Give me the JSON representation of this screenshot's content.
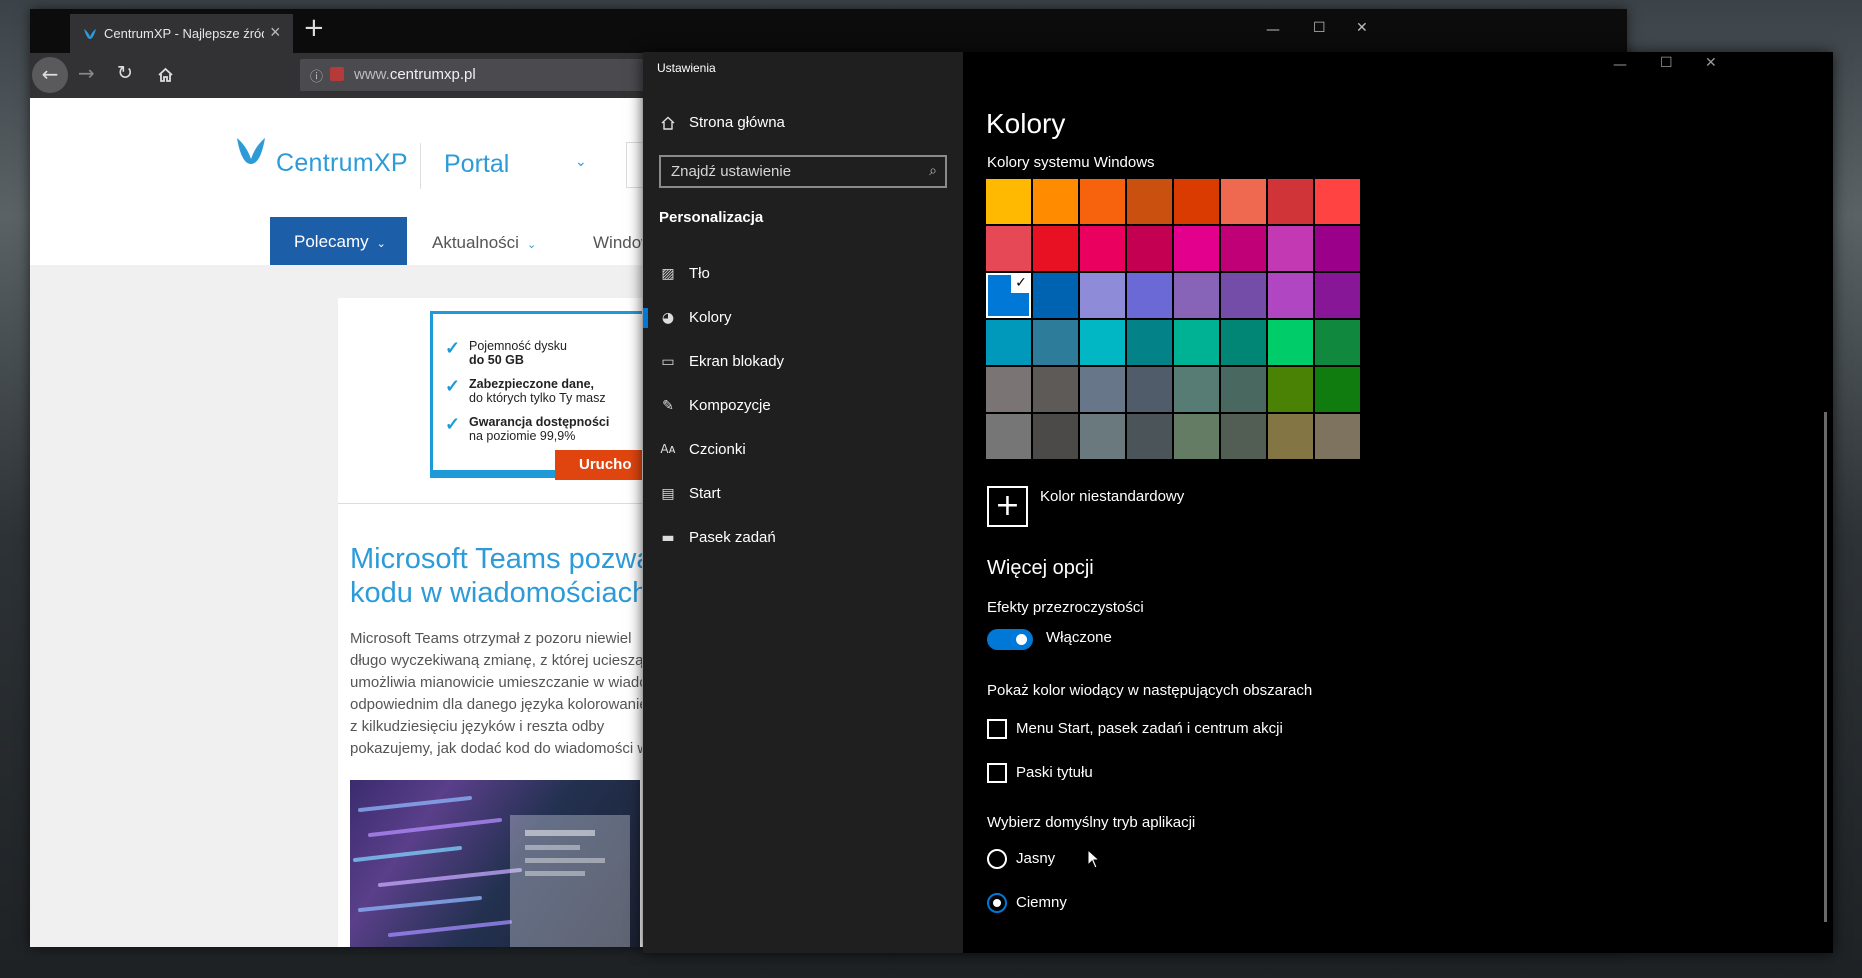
{
  "browser": {
    "tab_title": "CentrumXP - Najlepsze źródło",
    "url_domain": "www.",
    "url_host": "centrumxp.pl",
    "window_controls": {
      "minimize": "—",
      "maximize": "☐",
      "close": "✕"
    }
  },
  "website": {
    "logo_text": "CentrumXP",
    "portal_label": "Portal",
    "nav": [
      {
        "label": "Polecamy"
      },
      {
        "label": "Aktualności"
      },
      {
        "label": "Window"
      }
    ],
    "ad": {
      "items": [
        {
          "line1": "Pojemność dysku",
          "line2": "do 50 GB"
        },
        {
          "line1": "Zabezpieczone dane,",
          "line2": "do których tylko Ty masz"
        },
        {
          "line1": "Gwarancja dostępności",
          "line2": "na poziomie 99,9%"
        }
      ],
      "button": "Urucho"
    },
    "article": {
      "title_line1": "Microsoft Teams pozwala",
      "title_line2": "kodu w wiadomościach",
      "body_lines": [
        "Microsoft Teams otrzymał z pozoru niewiel",
        "długo wyczekiwaną zmianę, z której ucieszą si",
        "umożliwia mianowicie umieszczanie w wiadom",
        "odpowiednim dla danego języka kolorowanie",
        "z kilkudziesięciu języków i reszta odby",
        "pokazujemy, jak dodać kod do wiadomości w p"
      ]
    }
  },
  "settings": {
    "window_title": "Ustawienia",
    "window_controls": {
      "minimize": "—",
      "maximize": "☐",
      "close": "✕"
    },
    "home": "Strona główna",
    "search_placeholder": "Znajdź ustawienie",
    "section": "Personalizacja",
    "nav_items": [
      {
        "label": "Tło",
        "icon": "picture-icon"
      },
      {
        "label": "Kolory",
        "icon": "palette-icon"
      },
      {
        "label": "Ekran blokady",
        "icon": "lock-screen-icon"
      },
      {
        "label": "Kompozycje",
        "icon": "themes-icon"
      },
      {
        "label": "Czcionki",
        "icon": "fonts-icon"
      },
      {
        "label": "Start",
        "icon": "start-icon"
      },
      {
        "label": "Pasek zadań",
        "icon": "taskbar-icon"
      }
    ],
    "page_title": "Kolory",
    "windows_colors_label": "Kolory systemu Windows",
    "swatches": [
      [
        "#FFB900",
        "#FF8C00",
        "#F7630C",
        "#CA5010",
        "#DA3B01",
        "#EF6950",
        "#D13438",
        "#FF4343"
      ],
      [
        "#E74856",
        "#E81123",
        "#EA005E",
        "#C30052",
        "#E3008C",
        "#BF0077",
        "#C239B3",
        "#9A0089"
      ],
      [
        "#0078D7",
        "#0063B1",
        "#8E8CD8",
        "#6B69D6",
        "#8764B8",
        "#744DA9",
        "#B146C2",
        "#881798"
      ],
      [
        "#0099BC",
        "#2D7D9A",
        "#00B7C3",
        "#038387",
        "#00B294",
        "#018574",
        "#00CC6A",
        "#10893E"
      ],
      [
        "#7A7574",
        "#5D5A58",
        "#68768A",
        "#515C6B",
        "#567C73",
        "#486860",
        "#498205",
        "#107C10"
      ],
      [
        "#767676",
        "#4C4A48",
        "#69797E",
        "#4A5459",
        "#647C64",
        "#525E54",
        "#847545",
        "#7E735F"
      ]
    ],
    "selected_swatch": "#0078D7",
    "custom_color": "Kolor niestandardowy",
    "more_options": "Więcej opcji",
    "transparency_label": "Efekty przezroczystości",
    "transparency_state": "Włączone",
    "transparency_on": true,
    "accent_label": "Pokaż kolor wiodący w następujących obszarach",
    "checkboxes": [
      {
        "label": "Menu Start, pasek zadań i centrum akcji",
        "checked": false
      },
      {
        "label": "Paski tytułu",
        "checked": false
      }
    ],
    "mode_label": "Wybierz domyślny tryb aplikacji",
    "modes": [
      {
        "label": "Jasny",
        "selected": false
      },
      {
        "label": "Ciemny",
        "selected": true
      }
    ],
    "accent_color": "#0078D7"
  }
}
